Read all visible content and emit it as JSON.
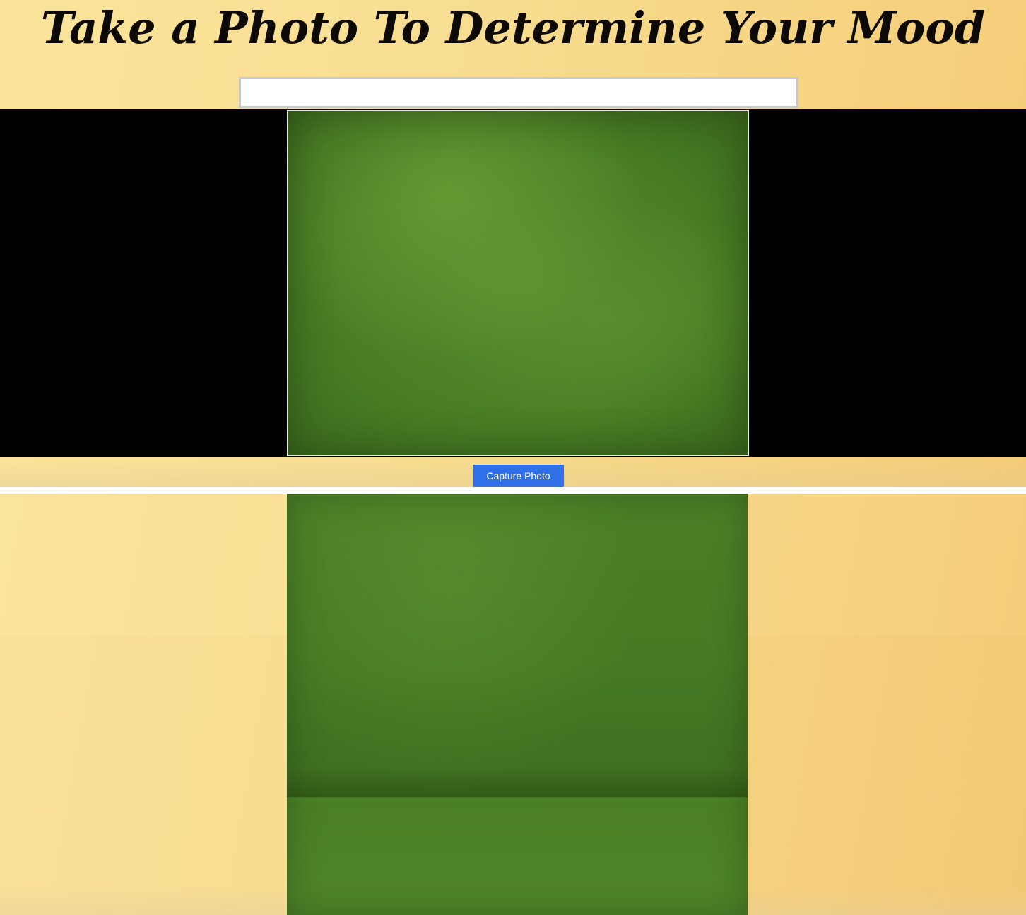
{
  "page": {
    "title": "Take a Photo To Determine Your Mood"
  },
  "input": {
    "value": "",
    "placeholder": ""
  },
  "camera": {
    "capture_label": "Capture Photo"
  },
  "colors": {
    "background_gold": "#f8de92",
    "video_letterbox": "#000000",
    "button_blue": "#2f6fe8",
    "feed_green": "#4a7f25"
  }
}
